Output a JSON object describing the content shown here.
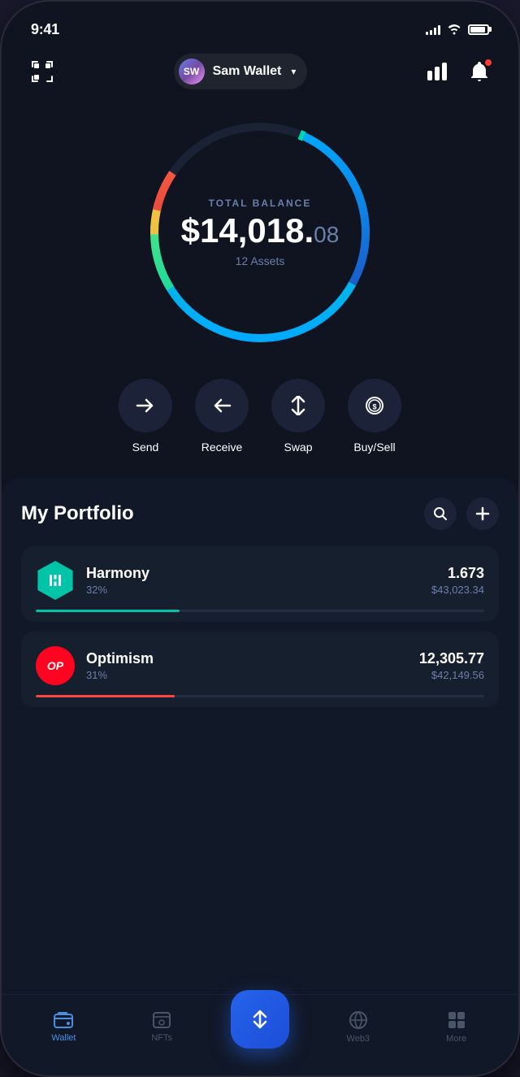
{
  "statusBar": {
    "time": "9:41",
    "signal": [
      3,
      5,
      7,
      9,
      11
    ],
    "wifi": "📶",
    "battery": 90
  },
  "header": {
    "walletInitials": "SW",
    "walletName": "Sam Wallet",
    "chevron": "▾",
    "scannerLabel": "scanner",
    "chartLabel": "chart",
    "notificationLabel": "notification"
  },
  "balance": {
    "label": "TOTAL BALANCE",
    "whole": "$14,018.",
    "cents": "08",
    "assets": "12 Assets"
  },
  "actions": [
    {
      "id": "send",
      "label": "Send",
      "icon": "→"
    },
    {
      "id": "receive",
      "label": "Receive",
      "icon": "←"
    },
    {
      "id": "swap",
      "label": "Swap",
      "icon": "⇅"
    },
    {
      "id": "buysell",
      "label": "Buy/Sell",
      "icon": "⊙"
    }
  ],
  "portfolio": {
    "title": "My Portfolio",
    "searchLabel": "search",
    "addLabel": "add"
  },
  "assets": [
    {
      "id": "harmony",
      "name": "Harmony",
      "percent": "32%",
      "amount": "1.673",
      "usd": "$43,023.34",
      "barWidth": "32%",
      "iconText": "⟁",
      "colorClass": "harmony"
    },
    {
      "id": "optimism",
      "name": "Optimism",
      "percent": "31%",
      "amount": "12,305.77",
      "usd": "$42,149.56",
      "barWidth": "31%",
      "iconText": "OP",
      "colorClass": "optimism"
    }
  ],
  "bottomNav": [
    {
      "id": "wallet",
      "label": "Wallet",
      "icon": "💳",
      "active": true
    },
    {
      "id": "nfts",
      "label": "NFTs",
      "icon": "🖼",
      "active": false
    },
    {
      "id": "swap-center",
      "label": "",
      "icon": "⇅",
      "active": false,
      "isCenter": true
    },
    {
      "id": "web3",
      "label": "Web3",
      "icon": "🌐",
      "active": false
    },
    {
      "id": "more",
      "label": "More",
      "icon": "⋯",
      "active": false
    }
  ]
}
